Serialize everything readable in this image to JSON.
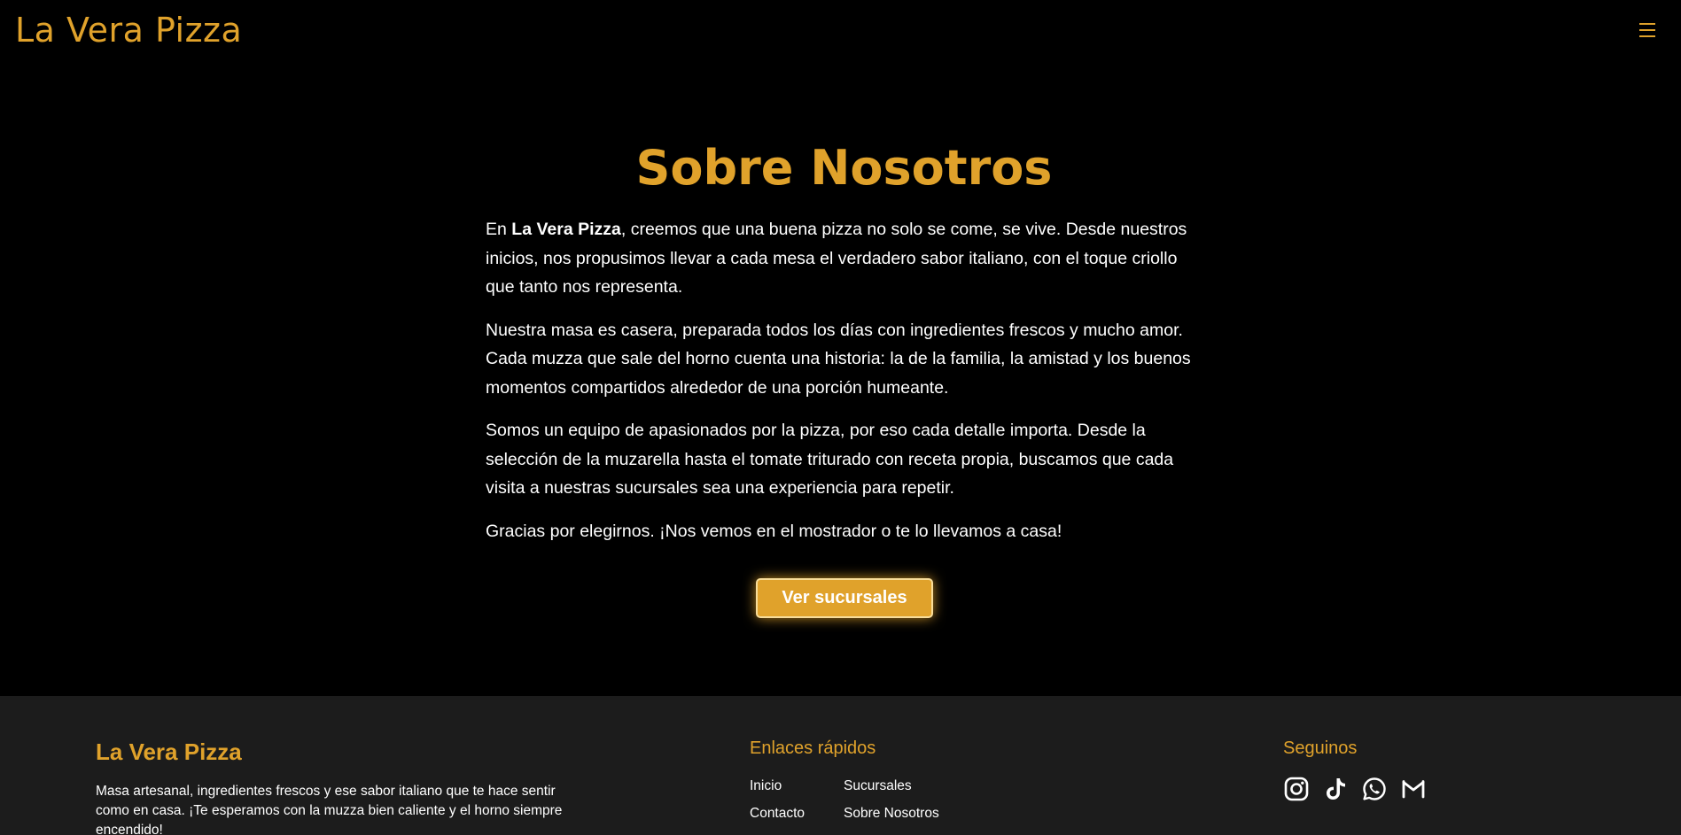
{
  "header": {
    "brand": "La Vera Pizza",
    "menu_icon": "hamburger-menu-icon"
  },
  "main": {
    "title": "Sobre Nosotros",
    "p1_lead": "En ",
    "p1_bold": "La Vera Pizza",
    "p1_rest": ", creemos que una buena pizza no solo se come, se vive. Desde nuestros inicios, nos propusimos llevar a cada mesa el verdadero sabor italiano, con el toque criollo que tanto nos representa.",
    "p2": "Nuestra masa es casera, preparada todos los días con ingredientes frescos y mucho amor. Cada muzza que sale del horno cuenta una historia: la de la familia, la amistad y los buenos momentos compartidos alrededor de una porción humeante.",
    "p3": "Somos un equipo de apasionados por la pizza, por eso cada detalle importa. Desde la selección de la muzarella hasta el tomate triturado con receta propia, buscamos que cada visita a nuestras sucursales sea una experiencia para repetir.",
    "p4": "Gracias por elegirnos. ¡Nos vemos en el mostrador o te lo llevamos a casa!",
    "cta_label": "Ver sucursales"
  },
  "footer": {
    "brand": "La Vera Pizza",
    "description": "Masa artesanal, ingredientes frescos y ese sabor italiano que te hace sentir como en casa. ¡Te esperamos con la muzza bien caliente y el horno siempre encendido!",
    "links_heading": "Enlaces rápidos",
    "links": [
      "Inicio",
      "Sucursales",
      "Contacto",
      "Sobre Nosotros"
    ],
    "social_heading": "Seguinos",
    "social_icons": [
      "instagram-icon",
      "tiktok-icon",
      "whatsapp-icon",
      "gmail-icon"
    ]
  },
  "colors": {
    "accent": "#e0a22b",
    "background": "#000000",
    "footer_background": "#1c1c1c",
    "text": "#ffffff"
  }
}
